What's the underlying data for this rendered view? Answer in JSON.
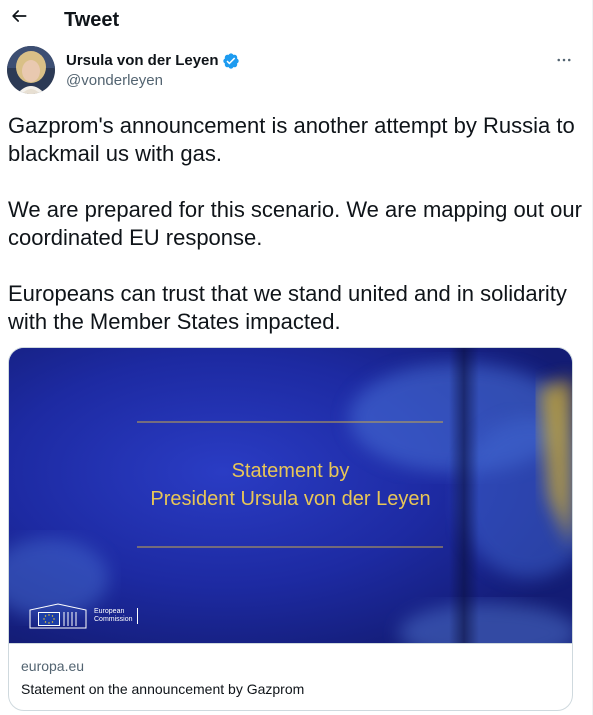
{
  "header": {
    "back_icon": "arrow-left-icon",
    "title": "Tweet"
  },
  "author": {
    "name": "Ursula von der Leyen",
    "handle": "@vonderleyen",
    "verified_icon": "verified-badge-icon",
    "verified_color": "#1d9bf0"
  },
  "more_icon": "more-horizontal-icon",
  "tweet": {
    "paragraphs": [
      "Gazprom's announcement is another attempt by Russia to blackmail us with gas.",
      "We are prepared for this scenario. We are mapping out our coordinated EU response.",
      "Europeans can trust that we stand united and in solidarity with the Member States impacted."
    ]
  },
  "card": {
    "image": {
      "line1": "Statement by",
      "line2": "President Ursula von der Leyen",
      "logo_line1": "European",
      "logo_line2": "Commission",
      "accent_color": "#e8c657",
      "background_color": "#1a2a9e"
    },
    "domain": "europa.eu",
    "title": "Statement on the announcement by Gazprom"
  }
}
